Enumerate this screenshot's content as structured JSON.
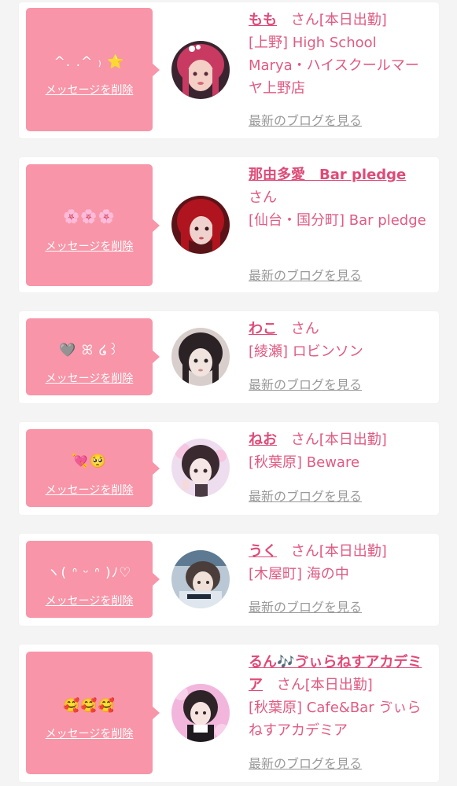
{
  "delete_label": "メッセージを削除",
  "blog_label": "最新のブログを見る",
  "san_label": "さん",
  "colors": {
    "accent_pink": "#f895a8",
    "name_pink": "#de4b78",
    "text_pink": "#e05a82",
    "link_gray": "#9a9a9a"
  },
  "cards": [
    {
      "message": "^. .^ ₎ ⭐",
      "name": "もも",
      "status": "[本日出勤]",
      "area": "[上野]",
      "shop": "High School Marya・ハイスクールマーヤ上野店",
      "avatar_icon": "avatar-red-hair"
    },
    {
      "message": "🌸🌸🌸",
      "name": "那由多愛　Bar pledge",
      "status": "",
      "area": "[仙台・国分町]",
      "shop": "Bar pledge",
      "avatar_icon": "avatar-red-hair"
    },
    {
      "message": "🩶 ꕤ ໒꒱",
      "name": "わこ",
      "status": "",
      "area": "[綾瀬]",
      "shop": "ロビンソン",
      "avatar_icon": "avatar-dark-hair"
    },
    {
      "message": "💘🥺",
      "name": "ねお",
      "status": "[本日出勤]",
      "area": "[秋葉原]",
      "shop": "Beware",
      "avatar_icon": "avatar-peace-sign"
    },
    {
      "message": "ヽ( ᐢ ᵕ ᐢ )ﾉ♡",
      "name": "うく",
      "status": "[本日出勤]",
      "area": "[木屋町]",
      "shop": "海の中",
      "avatar_icon": "avatar-blue"
    },
    {
      "message": "🥰🥰🥰",
      "name": "るん🎶ゔぃらねすアカデミア",
      "status": "[本日出勤]",
      "area": "[秋葉原]",
      "shop": "Cafe&Bar ゔぃらねすアカデミア",
      "avatar_icon": "avatar-pink-maid"
    }
  ]
}
